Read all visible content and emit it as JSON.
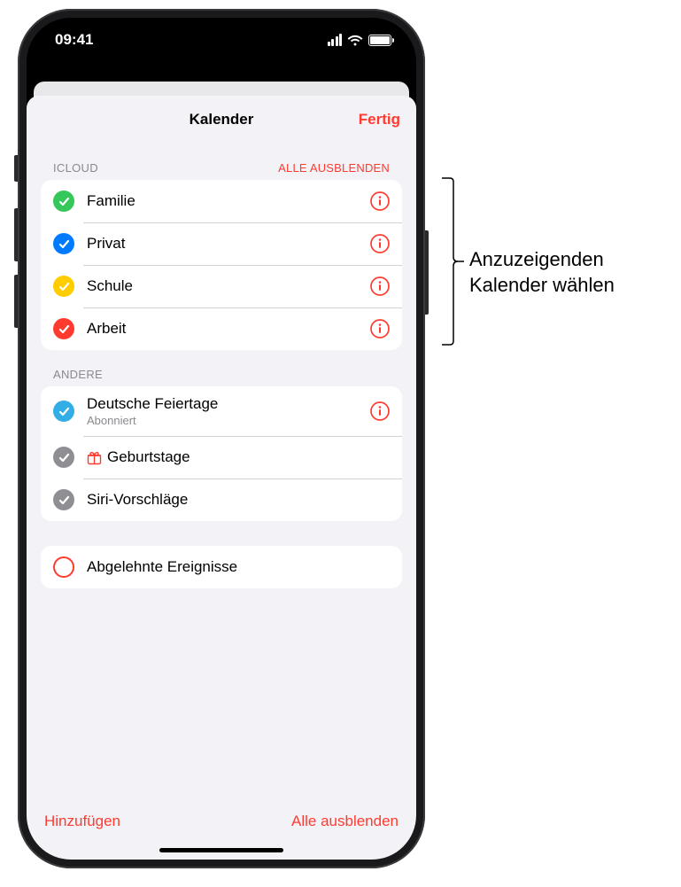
{
  "status": {
    "time": "09:41"
  },
  "modal": {
    "title": "Kalender",
    "done": "Fertig"
  },
  "sections": {
    "icloud": {
      "header": "ICLOUD",
      "action": "ALLE AUSBLENDEN",
      "items": {
        "familie": {
          "label": "Familie",
          "color": "#34c759"
        },
        "privat": {
          "label": "Privat",
          "color": "#007aff"
        },
        "schule": {
          "label": "Schule",
          "color": "#ffcc00"
        },
        "arbeit": {
          "label": "Arbeit",
          "color": "#ff3b30"
        }
      }
    },
    "andere": {
      "header": "ANDERE",
      "items": {
        "feiertage": {
          "label": "Deutsche Feiertage",
          "sub": "Abonniert",
          "color": "#32ade6"
        },
        "geburtstage": {
          "label": "Geburtstage",
          "color": "#8e8e93"
        },
        "siri": {
          "label": "Siri-Vorschläge",
          "color": "#8e8e93"
        }
      }
    },
    "declined": {
      "label": "Abgelehnte Ereignisse"
    }
  },
  "bottom": {
    "add": "Hinzufügen",
    "hideAll": "Alle ausblenden"
  },
  "callout": "Anzuzeigenden\nKalender wählen"
}
